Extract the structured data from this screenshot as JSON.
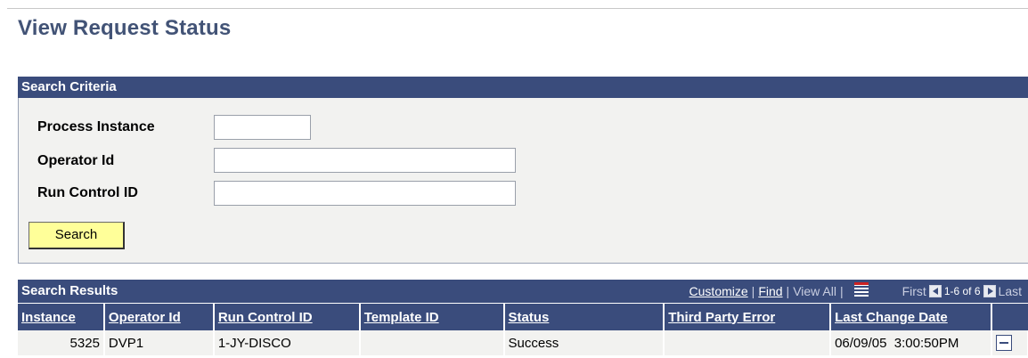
{
  "page": {
    "title": "View Request Status"
  },
  "criteria": {
    "header": "Search Criteria",
    "process_instance_label": "Process Instance",
    "process_instance_value": "",
    "operator_id_label": "Operator Id",
    "operator_id_value": "",
    "run_control_label": "Run Control ID",
    "run_control_value": "",
    "search_label": "Search"
  },
  "results": {
    "header": "Search Results",
    "customize": "Customize",
    "find": "Find",
    "view_all": "View All",
    "first": "First",
    "range": "1-6 of 6",
    "last": "Last",
    "columns": [
      "Instance",
      "Operator Id",
      "Run Control ID",
      "Template ID",
      "Status",
      "Third Party Error",
      "Last Change Date"
    ],
    "rows": [
      {
        "instance": "5325",
        "operator": "DVP1",
        "run_control": "1-JY-DISCO",
        "template": "",
        "status": "Success",
        "error": "",
        "date": "06/09/05  3:00:50PM"
      }
    ]
  },
  "icons": {
    "grid": "spreadsheet-icon",
    "prev": "prev-arrow-icon",
    "next": "next-arrow-icon",
    "delete": "delete-row-icon"
  },
  "colors": {
    "header_bg": "#3a4c7c",
    "title": "#425376",
    "button_bg": "#ffff99",
    "panel_bg": "#f2f2f0"
  }
}
